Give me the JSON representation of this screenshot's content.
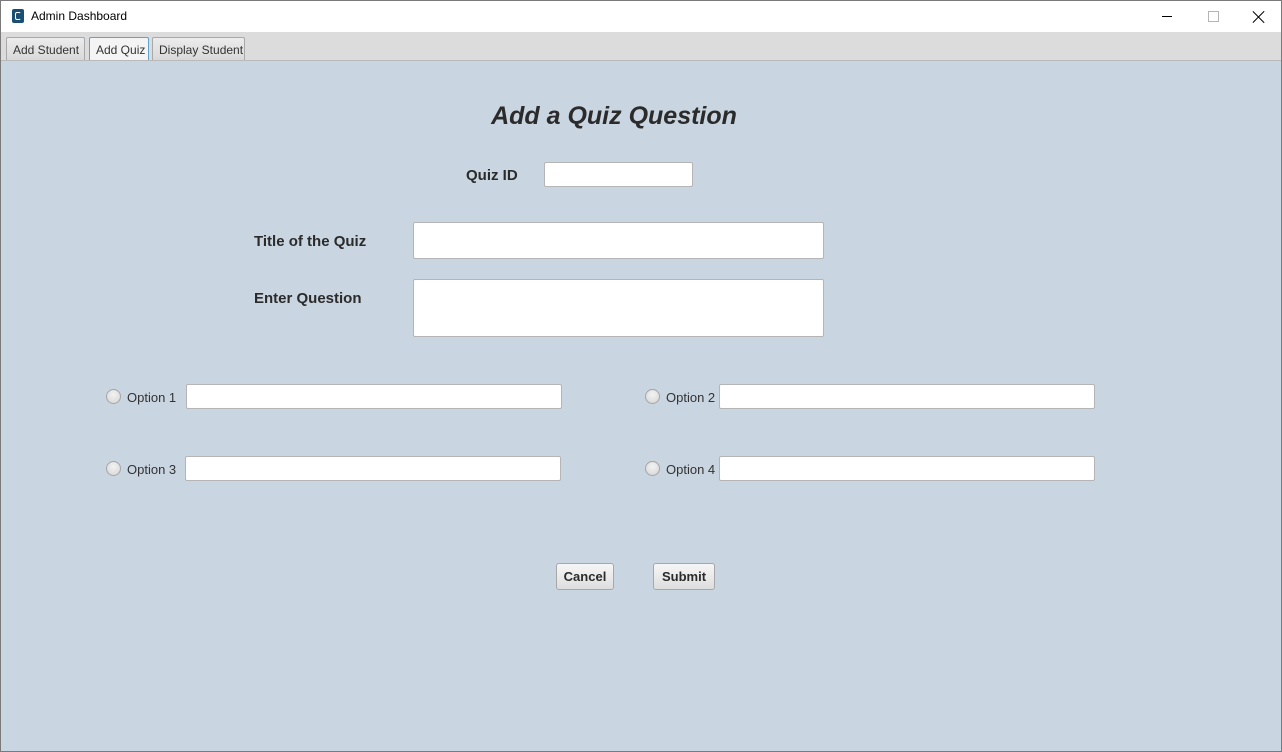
{
  "window": {
    "title": "Admin Dashboard"
  },
  "tabs": [
    {
      "label": "Add Student"
    },
    {
      "label": "Add Quiz",
      "selected": true
    },
    {
      "label": "Display Student"
    }
  ],
  "form": {
    "heading": "Add a Quiz Question",
    "quiz_id_label": "Quiz ID",
    "quiz_id_value": "",
    "title_label": "Title of the Quiz",
    "title_value": "",
    "question_label": "Enter Question",
    "question_value": "",
    "options": [
      {
        "label": "Option 1",
        "value": "",
        "selected": false
      },
      {
        "label": "Option 2",
        "value": "",
        "selected": false
      },
      {
        "label": "Option 3",
        "value": "",
        "selected": false
      },
      {
        "label": "Option 4",
        "value": "",
        "selected": false
      }
    ],
    "cancel_label": "Cancel",
    "submit_label": "Submit"
  },
  "colors": {
    "content_background": "#c9d5e0",
    "selected_tab_border": "#5ea3cf",
    "app_icon": "#1a4f73"
  },
  "icons": [
    "app-icon",
    "minimize-icon",
    "maximize-icon",
    "close-icon"
  ]
}
